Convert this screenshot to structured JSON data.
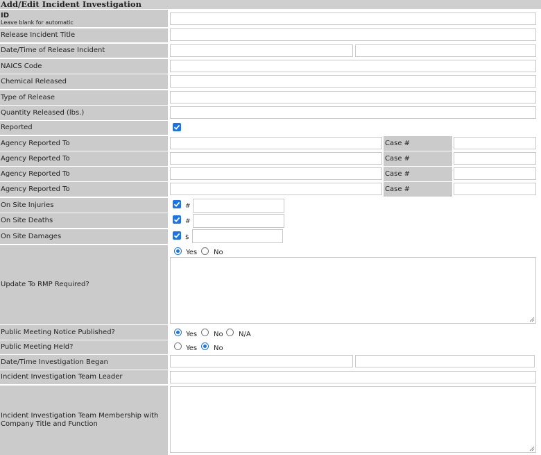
{
  "form_title": "Add/Edit Incident Investigation",
  "fields": {
    "id": {
      "label": "ID",
      "sublabel": "Leave blank for automatic",
      "value": ""
    },
    "release_title": {
      "label": "Release Incident Title",
      "value": ""
    },
    "release_datetime": {
      "label": "Date/Time of Release Incident",
      "date": "",
      "time": ""
    },
    "naics": {
      "label": "NAICS Code",
      "value": ""
    },
    "chemical": {
      "label": "Chemical Released",
      "value": ""
    },
    "release_type": {
      "label": "Type of Release",
      "value": ""
    },
    "quantity": {
      "label": "Quantity Released (lbs.)",
      "value": ""
    },
    "reported": {
      "label": "Reported",
      "checked": true
    },
    "agencies": [
      {
        "label": "Agency Reported To",
        "case_label": "Case #",
        "agency": "",
        "case": ""
      },
      {
        "label": "Agency Reported To",
        "case_label": "Case #",
        "agency": "",
        "case": ""
      },
      {
        "label": "Agency Reported To",
        "case_label": "Case #",
        "agency": "",
        "case": ""
      },
      {
        "label": "Agency Reported To",
        "case_label": "Case #",
        "agency": "",
        "case": ""
      }
    ],
    "injuries": {
      "label": "On Site Injuries",
      "checked": true,
      "symbol": "#",
      "value": ""
    },
    "deaths": {
      "label": "On Site Deaths",
      "checked": true,
      "symbol": "#",
      "value": ""
    },
    "damages": {
      "label": "On Site Damages",
      "checked": true,
      "symbol": "$",
      "value": ""
    },
    "rmp_update": {
      "label": "Update To RMP Required?",
      "yes": "Yes",
      "no": "No",
      "selected": "Yes",
      "notes": ""
    },
    "notice_published": {
      "label": "Public Meeting Notice Published?",
      "yes": "Yes",
      "no": "No",
      "na": "N/A",
      "selected": "Yes"
    },
    "meeting_held": {
      "label": "Public Meeting Held?",
      "yes": "Yes",
      "no": "No",
      "selected": "No"
    },
    "investigation_began": {
      "label": "Date/Time Investigation Began",
      "date": "",
      "time": ""
    },
    "team_leader": {
      "label": "Incident Investigation Team Leader",
      "value": ""
    },
    "team_membership": {
      "label": "Incident Investigation Team Membership with Company Title and Function",
      "value": ""
    }
  },
  "colors": {
    "label_bg": "#cbcbcb",
    "accent": "#1a73e8",
    "border": "#c8c8c8"
  }
}
